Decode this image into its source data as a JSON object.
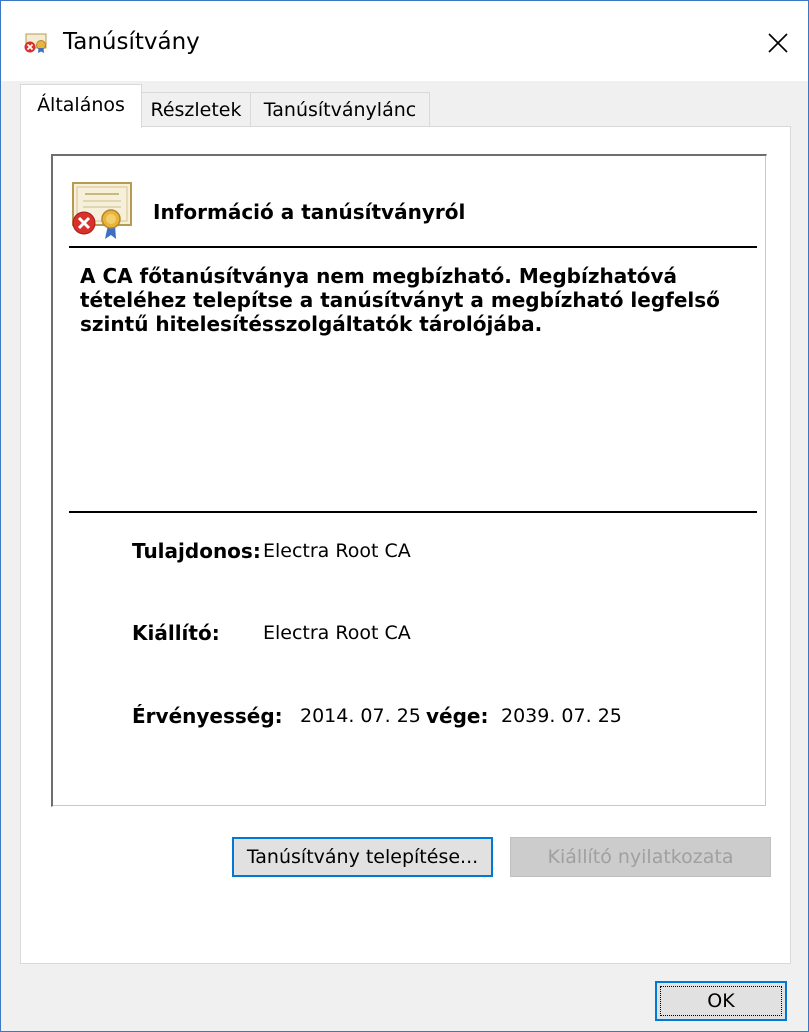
{
  "window": {
    "title": "Tanúsítvány",
    "close_glyph": "✕"
  },
  "tabs": [
    {
      "label": "Általános",
      "active": true
    },
    {
      "label": "Részletek",
      "active": false
    },
    {
      "label": "Tanúsítványlánc",
      "active": false
    }
  ],
  "info": {
    "title": "Információ a tanúsítványról",
    "warning": "A CA főtanúsítványa nem megbízható. Megbízhatóvá tételéhez telepítse a tanúsítványt a megbízható legfelső szintű hitelesítésszolgáltatók tárolójába.",
    "owner_label": "Tulajdonos:",
    "owner_value": "Electra Root CA",
    "issuer_label": "Kiállító:",
    "issuer_value": "Electra Root CA",
    "validity_label": "Érvényesség:",
    "valid_from": "2014. 07. 25",
    "valid_to_label": "vége:",
    "valid_to": "2039. 07. 25"
  },
  "buttons": {
    "install": "Tanúsítvány telepítése...",
    "issuer_statement": "Kiállító nyilatkozata",
    "ok": "OK"
  },
  "colors": {
    "accent": "#0078d7",
    "error_red": "#d9302c",
    "seal_gold": "#e8b43a"
  }
}
